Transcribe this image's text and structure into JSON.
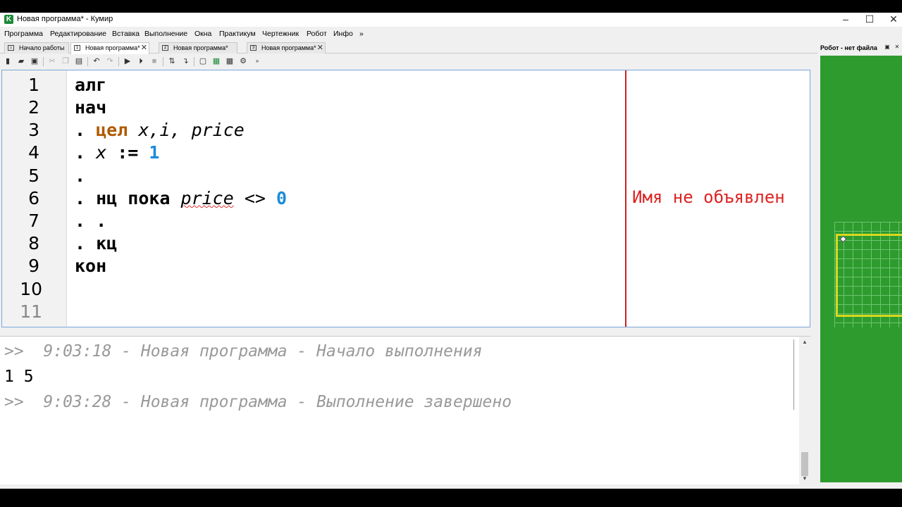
{
  "window": {
    "title": "Новая программа* - Кумир",
    "icon_letter": "K"
  },
  "menu": [
    "Программа",
    "Редактирование",
    "Вставка",
    "Выполнение",
    "Окна",
    "Практикум",
    "Чертежник",
    "Робот",
    "Инфо",
    "»"
  ],
  "tabs": [
    {
      "label": "Начало работы",
      "num": "",
      "closable": false
    },
    {
      "label": "Новая программа*",
      "num": "1",
      "closable": true,
      "active": true
    },
    {
      "label": "Новая программа*",
      "num": "2",
      "closable": true
    },
    {
      "label": "Новая программа*",
      "num": "3",
      "closable": true
    }
  ],
  "editor": {
    "line_numbers": [
      "1",
      "2",
      "3",
      "4",
      "5",
      "6",
      "7",
      "8",
      "9",
      "10",
      "11"
    ],
    "code": {
      "l1": "алг",
      "l2": "нач",
      "l3_dot": ". ",
      "l3_kw": "цел",
      "l3_vars": " x,i,",
      "l3_var2": " price",
      "l4_dot": ". ",
      "l4_var": "x",
      "l4_op": " := ",
      "l4_num": "1",
      "l5": ".",
      "l6_dot": ". ",
      "l6_kw": "нц пока",
      "l6_sp": " ",
      "l6_var": "price",
      "l6_op": " <> ",
      "l6_num": "0",
      "l7": ". .",
      "l8_dot": ". ",
      "l8_kw": "кц",
      "l9": "кон"
    },
    "error_message": "Имя не объявлен"
  },
  "console": {
    "lines": [
      ">>  9:03:18 - Новая программа - Начало выполнения",
      "1 5",
      ">>  9:03:28 - Новая программа - Выполнение завершено"
    ]
  },
  "robot_panel": {
    "title": "Робот - нет файла"
  },
  "colors": {
    "keyword_type": "#b05a00",
    "number": "#1a8cd8",
    "error": "#cc2222",
    "robot_field": "#2e9b2e",
    "robot_wall": "#d8d820"
  }
}
